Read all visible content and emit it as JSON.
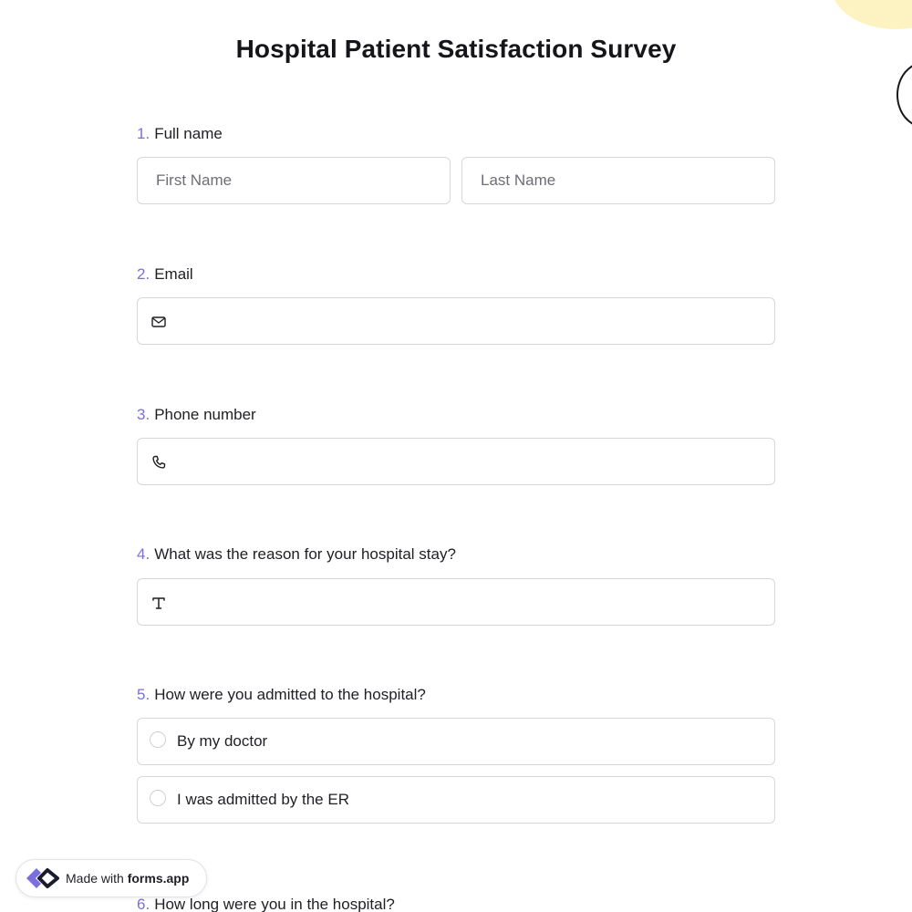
{
  "survey": {
    "title": "Hospital Patient Satisfaction Survey"
  },
  "questions": [
    {
      "number": "1.",
      "label": "Full name",
      "fields": [
        {
          "placeholder": "First Name",
          "value": ""
        },
        {
          "placeholder": "Last Name",
          "value": ""
        }
      ]
    },
    {
      "number": "2.",
      "label": "Email",
      "icon": "envelope-icon",
      "value": ""
    },
    {
      "number": "3.",
      "label": "Phone number",
      "icon": "phone-icon",
      "value": ""
    },
    {
      "number": "4.",
      "label": "What was the reason for your hospital stay?",
      "icon": "text-icon",
      "value": ""
    },
    {
      "number": "5.",
      "label": "How were you admitted to the hospital?",
      "options": [
        "By my doctor",
        "I was admitted by the ER"
      ]
    },
    {
      "number": "6.",
      "label": "How long were you in the hospital?"
    }
  ],
  "badge": {
    "made_with": "Made with",
    "brand": "forms.app"
  },
  "colors": {
    "accent": "#7b6fe0",
    "border": "#d6d6dc",
    "decor_yellow": "#fdf3c2",
    "text": "#1f1f24"
  }
}
